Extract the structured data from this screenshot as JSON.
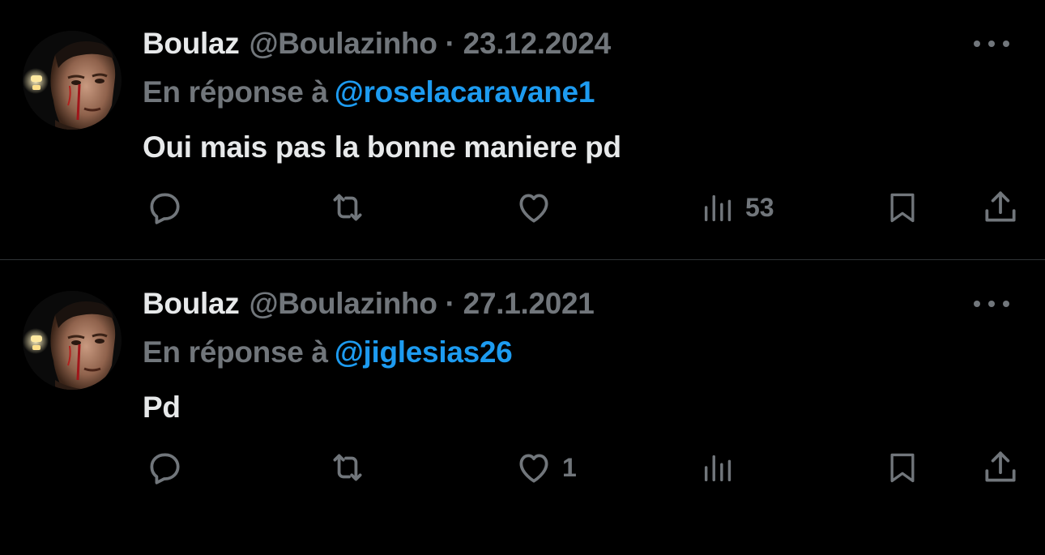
{
  "tweets": [
    {
      "author": {
        "display_name": "Boulaz",
        "handle": "@Boulazinho"
      },
      "separator": "·",
      "date": "23.12.2024",
      "reply_prefix": "En réponse à",
      "reply_target": "@roselacaravane1",
      "text": "Oui mais pas la bonne maniere pd",
      "counts": {
        "replies": "",
        "retweets": "",
        "likes": "",
        "views": "53"
      }
    },
    {
      "author": {
        "display_name": "Boulaz",
        "handle": "@Boulazinho"
      },
      "separator": "·",
      "date": "27.1.2021",
      "reply_prefix": "En réponse à",
      "reply_target": "@jiglesias26",
      "text": "Pd",
      "counts": {
        "replies": "",
        "retweets": "",
        "likes": "1",
        "views": ""
      }
    }
  ],
  "icons": [
    "more-icon",
    "reply-icon",
    "retweet-icon",
    "like-icon",
    "views-icon",
    "bookmark-icon",
    "share-icon"
  ],
  "colors": {
    "background": "#000000",
    "primary_text": "#e7e9ea",
    "secondary_text": "#71767b",
    "accent": "#1d9bf0",
    "divider": "#2f3336"
  }
}
